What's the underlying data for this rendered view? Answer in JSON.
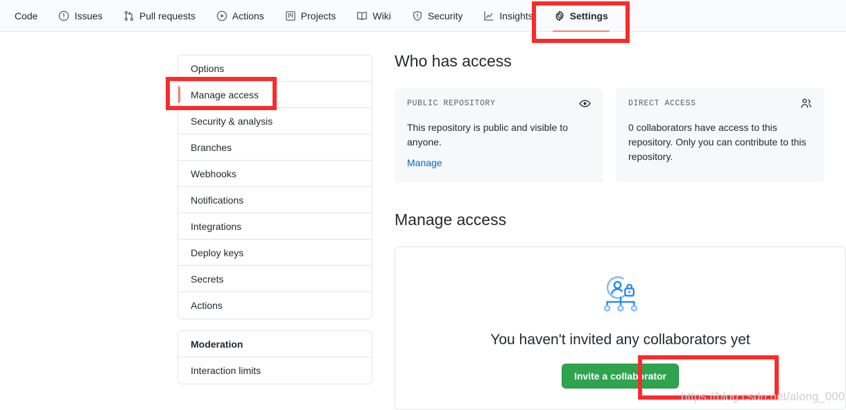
{
  "repo_nav": {
    "items": [
      {
        "label": "Code",
        "icon": "code-icon",
        "selected": false
      },
      {
        "label": "Issues",
        "icon": "issue-opened-icon",
        "selected": false
      },
      {
        "label": "Pull requests",
        "icon": "git-pull-request-icon",
        "selected": false
      },
      {
        "label": "Actions",
        "icon": "play-icon",
        "selected": false
      },
      {
        "label": "Projects",
        "icon": "project-board-icon",
        "selected": false
      },
      {
        "label": "Wiki",
        "icon": "book-icon",
        "selected": false
      },
      {
        "label": "Security",
        "icon": "shield-icon",
        "selected": false
      },
      {
        "label": "Insights",
        "icon": "graph-icon",
        "selected": false
      },
      {
        "label": "Settings",
        "icon": "gear-icon",
        "selected": true
      }
    ]
  },
  "sidebar": {
    "groups": [
      {
        "items": [
          {
            "label": "Options",
            "active": false,
            "heading": false
          },
          {
            "label": "Manage access",
            "active": true,
            "heading": false
          },
          {
            "label": "Security & analysis",
            "active": false,
            "heading": false
          },
          {
            "label": "Branches",
            "active": false,
            "heading": false
          },
          {
            "label": "Webhooks",
            "active": false,
            "heading": false
          },
          {
            "label": "Notifications",
            "active": false,
            "heading": false
          },
          {
            "label": "Integrations",
            "active": false,
            "heading": false
          },
          {
            "label": "Deploy keys",
            "active": false,
            "heading": false
          },
          {
            "label": "Secrets",
            "active": false,
            "heading": false
          },
          {
            "label": "Actions",
            "active": false,
            "heading": false
          }
        ]
      },
      {
        "items": [
          {
            "label": "Moderation",
            "active": false,
            "heading": true
          },
          {
            "label": "Interaction limits",
            "active": false,
            "heading": false
          }
        ]
      }
    ]
  },
  "main": {
    "who_has_access_title": "Who has access",
    "cards": [
      {
        "label": "PUBLIC REPOSITORY",
        "icon": "eye-icon",
        "text": "This repository is public and visible to anyone.",
        "link": "Manage"
      },
      {
        "label": "DIRECT ACCESS",
        "icon": "people-icon",
        "text": "0 collaborators have access to this repository. Only you can contribute to this repository.",
        "link": ""
      }
    ],
    "manage_access_title": "Manage access",
    "empty_state": {
      "illustration": "person-lock-org-chart-illustration",
      "title": "You haven't invited any collaborators yet",
      "button_label": "Invite a collaborator"
    }
  },
  "annotations": {
    "color": "#fb2b2b",
    "boxes": [
      "settings-tab",
      "manage-access-sidebar-item",
      "invite-a-collaborator-button"
    ]
  },
  "watermark": {
    "text": "https://blog.csdn.net/along_000"
  }
}
